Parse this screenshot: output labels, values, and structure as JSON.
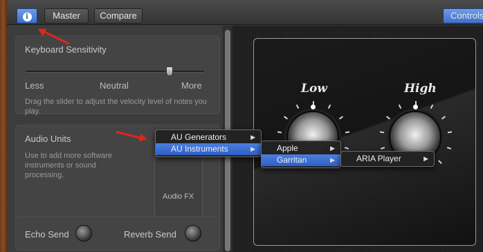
{
  "toolbar": {
    "info_glyph": "i",
    "master_label": "Master",
    "compare_label": "Compare",
    "controls_label": "Controls"
  },
  "keyboard_sensitivity": {
    "title": "Keyboard Sensitivity",
    "less": "Less",
    "neutral": "Neutral",
    "more": "More",
    "value_fraction": 0.82,
    "description": "Drag the slider to adjust the velocity level of notes you play."
  },
  "audio_units": {
    "title": "Audio Units",
    "description": "Use to add more software instruments or sound processing.",
    "fx_label": "Audio FX"
  },
  "sends": {
    "echo_label": "Echo Send",
    "reverb_label": "Reverb Send"
  },
  "controls_panel": {
    "knob_low_label": "Low",
    "knob_high_label": "High"
  },
  "menu_main": {
    "items": [
      {
        "label": "AU Generators",
        "selected": false
      },
      {
        "label": "AU Instruments",
        "selected": true
      }
    ]
  },
  "menu_manufacturers": {
    "items": [
      {
        "label": "Apple",
        "selected": false
      },
      {
        "label": "Garritan",
        "selected": true
      }
    ]
  },
  "menu_plugins": {
    "items": [
      {
        "label": "ARIA Player",
        "selected": false
      }
    ]
  },
  "colors": {
    "accent": "#3f6fc7",
    "annotation": "#e0261a"
  },
  "icons": {
    "info": "info-icon",
    "submenu": "chevron-right-icon"
  }
}
